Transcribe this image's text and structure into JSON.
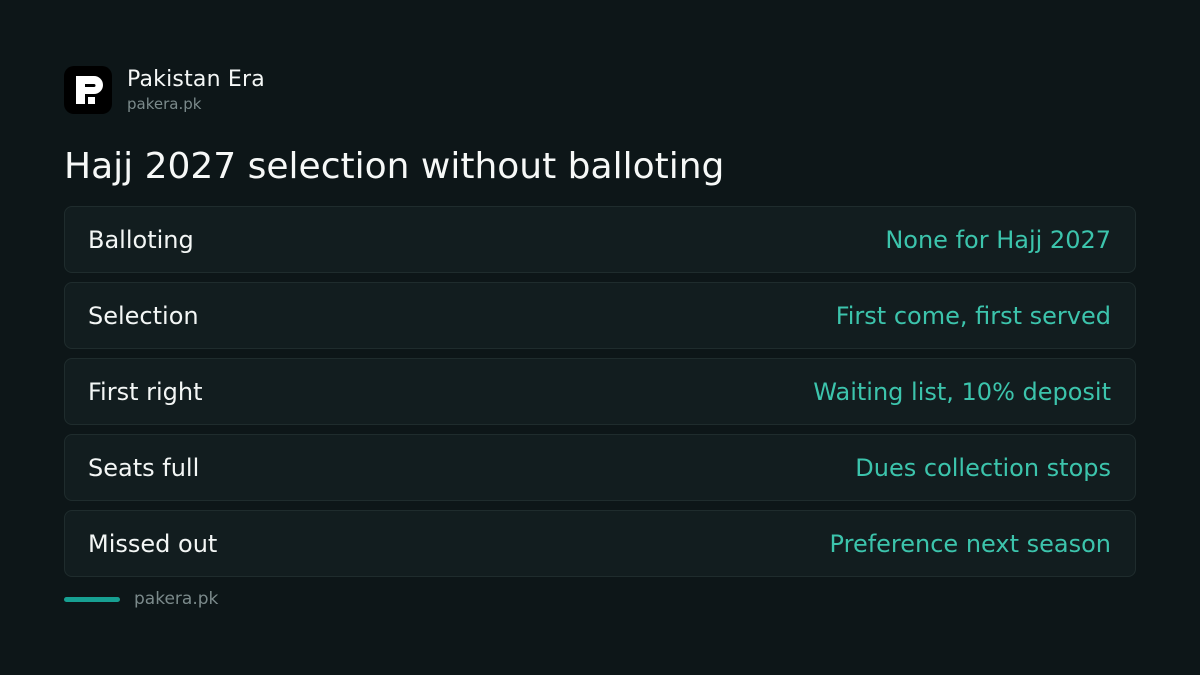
{
  "brand": {
    "name": "Pakistan Era",
    "domain": "pakera.pk",
    "logo_icon": "pakera-logo-icon"
  },
  "title": "Hajj 2027 selection without balloting",
  "rows": [
    {
      "label": "Balloting",
      "value": "None for Hajj 2027"
    },
    {
      "label": "Selection",
      "value": "First come, first served"
    },
    {
      "label": "First right",
      "value": "Waiting list, 10% deposit"
    },
    {
      "label": "Seats full",
      "value": "Dues collection stops"
    },
    {
      "label": "Missed out",
      "value": "Preference next season"
    }
  ],
  "footer": {
    "text": "pakera.pk"
  },
  "colors": {
    "background": "#0d1618",
    "row_background": "#121d1f",
    "row_border": "#1f2c2d",
    "accent": "#3cc4ac",
    "footer_bar": "#17a092",
    "muted_text": "#7b8a8b"
  }
}
